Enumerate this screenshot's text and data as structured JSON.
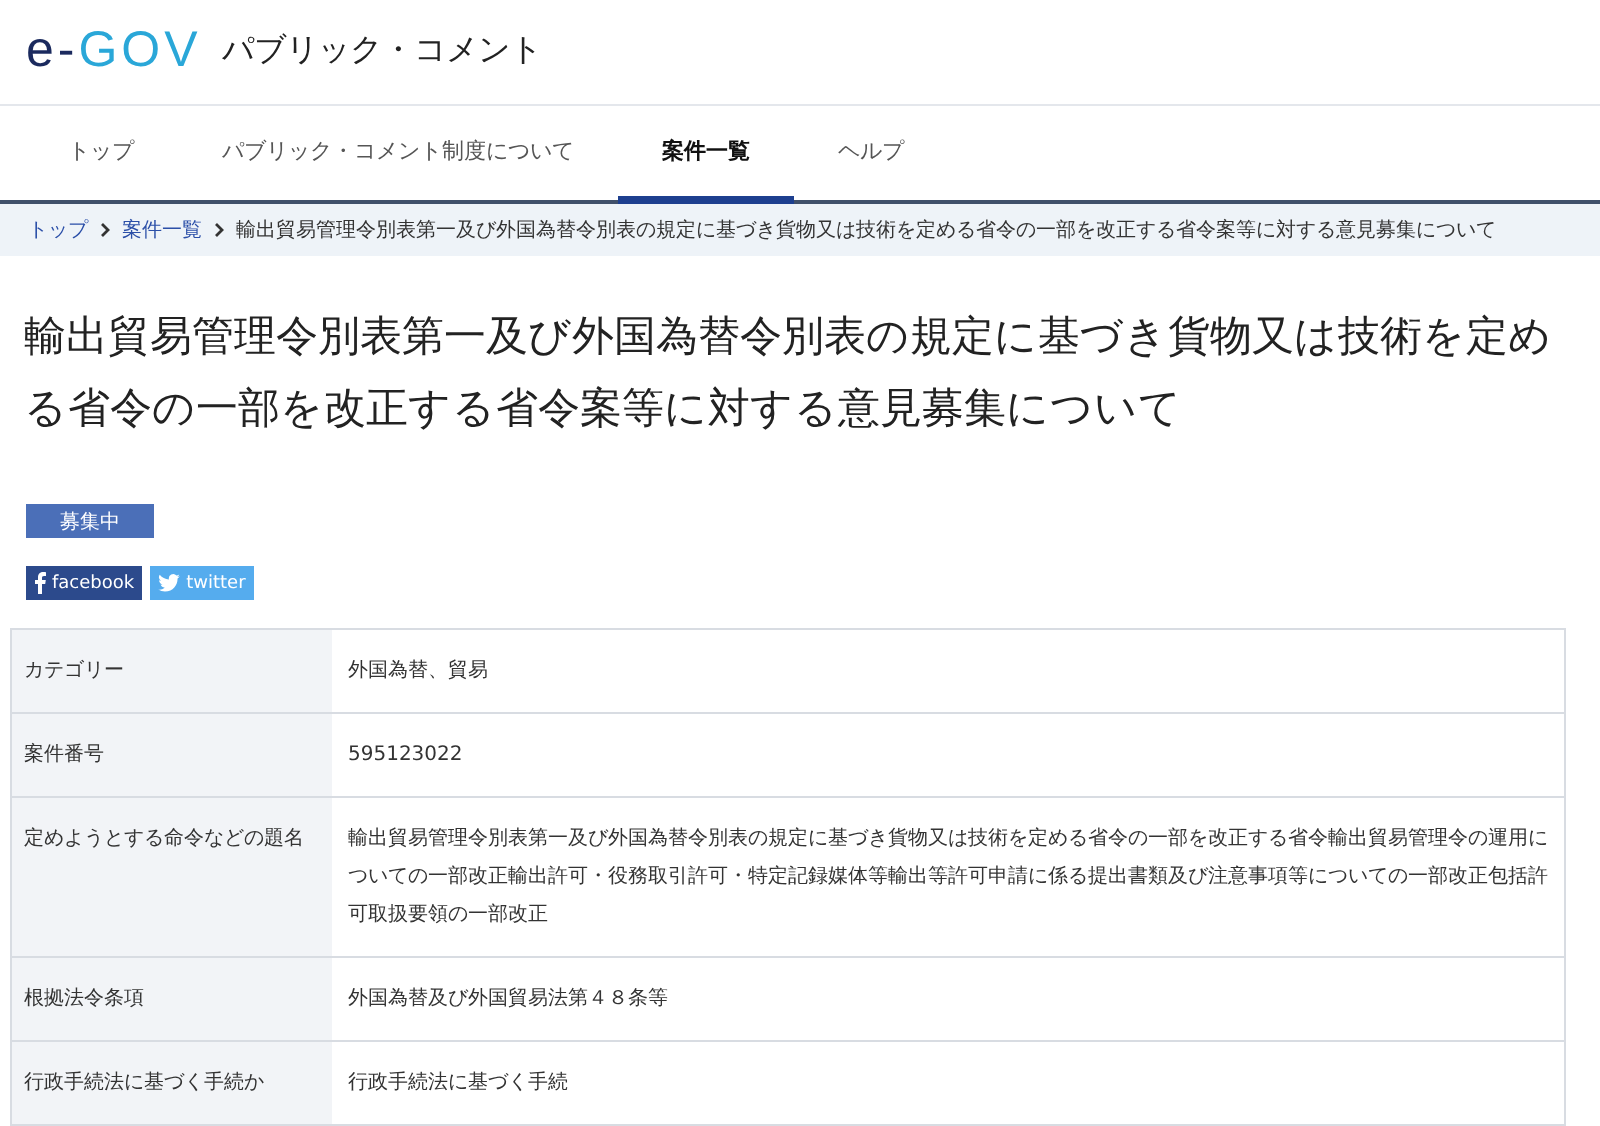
{
  "header": {
    "logo_prefix": "e-",
    "logo_main": "GOV",
    "site_title": "パブリック・コメント"
  },
  "nav": [
    {
      "label": "トップ",
      "selected": false
    },
    {
      "label": "パブリック・コメント制度について",
      "selected": false
    },
    {
      "label": "案件一覧",
      "selected": true
    },
    {
      "label": "ヘルプ",
      "selected": false
    }
  ],
  "breadcrumb": [
    {
      "label": "トップ",
      "kind": "link"
    },
    {
      "label": "案件一覧",
      "kind": "link"
    },
    {
      "label": "輸出貿易管理令別表第一及び外国為替令別表の規定に基づき貨物又は技術を定める省令の一部を改正する省令案等に対する意見募集について",
      "kind": "current"
    }
  ],
  "title": "輸出貿易管理令別表第一及び外国為替令別表の規定に基づき貨物又は技術を定める省令の一部を改正する省令案等に対する意見募集について",
  "status_badge": "募集中",
  "share_buttons": [
    {
      "label": "facebook",
      "kind": "facebook"
    },
    {
      "label": "twitter",
      "kind": "twitter"
    }
  ],
  "details": [
    {
      "label": "カテゴリー",
      "value": "外国為替、貿易"
    },
    {
      "label": "案件番号",
      "value": "595123022"
    },
    {
      "label": "定めようとする命令などの題名",
      "value": "輸出貿易管理令別表第一及び外国為替令別表の規定に基づき貨物又は技術を定める省令の一部を改正する省令輸出貿易管理令の運用についての一部改正輸出許可・役務取引許可・特定記録媒体等輸出等許可申請に係る提出書類及び注意事項等についての一部改正包括許可取扱要領の一部改正"
    },
    {
      "label": "根拠法令条項",
      "value": "外国為替及び外国貿易法第４８条等"
    },
    {
      "label": "行政手続法に基づく手続か",
      "value": "行政手続法に基づく手続"
    }
  ]
}
